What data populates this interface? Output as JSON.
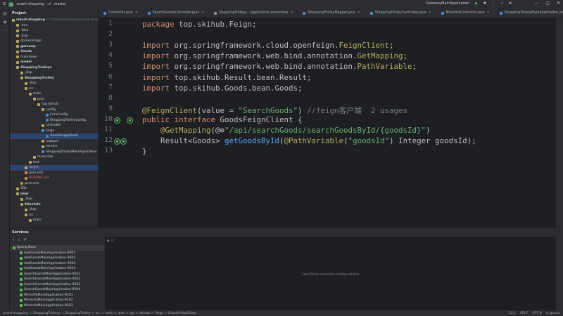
{
  "titlebar": {
    "project_badge": "SS",
    "project": "smart-shopping",
    "branch": "master",
    "run_config": "GatewayMainApplication"
  },
  "project_panel": {
    "title": "Project",
    "rows": [
      {
        "label": "smart-shopping",
        "hint": "C:\\Code\\JavaProject\\smart-shopping",
        "indent": 0,
        "bold": true
      },
      {
        "label": ".mrs",
        "indent": 1
      },
      {
        "label": ".idea",
        "indent": 1
      },
      {
        "label": ".jhsp",
        "indent": 1
      },
      {
        "label": "dockerimage",
        "indent": 1
      },
      {
        "label": "gateway",
        "indent": 1,
        "bold": true
      },
      {
        "label": "Goods",
        "indent": 1,
        "bold": true
      },
      {
        "label": "markdown",
        "indent": 1
      },
      {
        "label": "model",
        "indent": 1,
        "bold": true
      },
      {
        "label": "ShoppingTrolleys",
        "indent": 1,
        "bold": true
      },
      {
        "label": ".jhsp",
        "indent": 2
      },
      {
        "label": "ShoppingTrolley",
        "indent": 2,
        "bold": true
      },
      {
        "label": ".jhsp",
        "indent": 3
      },
      {
        "label": "src",
        "indent": 3
      },
      {
        "label": "main",
        "indent": 4
      },
      {
        "label": "java",
        "indent": 5
      },
      {
        "label": "top.skihub",
        "indent": 6
      },
      {
        "label": "config",
        "indent": 7
      },
      {
        "label": "CorsConfig",
        "indent": 8
      },
      {
        "label": "ShoppingTrolleyConfig",
        "indent": 8
      },
      {
        "label": "controller",
        "indent": 7
      },
      {
        "label": "Feign",
        "indent": 7
      },
      {
        "label": "GoodsFeignClient",
        "indent": 8,
        "selected": true
      },
      {
        "label": "mapper",
        "indent": 7
      },
      {
        "label": "service",
        "indent": 7
      },
      {
        "label": "ShoppingTrolleyMainApplication",
        "indent": 7
      },
      {
        "label": "resources",
        "indent": 5
      },
      {
        "label": "test",
        "indent": 4
      },
      {
        "label": "target",
        "indent": 3,
        "orange": true,
        "selected": true
      },
      {
        "label": "pom.xml",
        "indent": 3
      },
      {
        "label": "README.md",
        "indent": 3,
        "red": true
      },
      {
        "label": "pom.xml",
        "indent": 2
      },
      {
        "label": "SQL",
        "indent": 1
      },
      {
        "label": "User",
        "indent": 1,
        "bold": true
      },
      {
        "label": ".jhsp",
        "indent": 2
      },
      {
        "label": "MineInfo",
        "indent": 2,
        "bold": true
      },
      {
        "label": ".jhsp",
        "indent": 3
      },
      {
        "label": "src",
        "indent": 3
      },
      {
        "label": "main",
        "indent": 4
      }
    ]
  },
  "tabs": [
    {
      "label": "Controller.java"
    },
    {
      "label": "SearchGoodsController.java"
    },
    {
      "label": "ShoppingTrolley\\...\\application.properties"
    },
    {
      "label": "ShoppingTrolleyMapper.java"
    },
    {
      "label": "ShoppingTrolleyController.java"
    },
    {
      "label": "MineInfoController.java"
    },
    {
      "label": "ShoppingTrolleyMainApplication.java"
    },
    {
      "label": "GoodsFeignClient.java",
      "active": true
    }
  ],
  "editor": {
    "line_numbers": [
      "1",
      "2",
      "3",
      "4",
      "5",
      "6",
      "7",
      "8",
      "9",
      "10",
      "11",
      "12",
      "13"
    ],
    "lines": [
      [
        {
          "t": "package ",
          "c": "kw"
        },
        {
          "t": "top.skihub.Feign;"
        }
      ],
      [],
      [
        {
          "t": "import ",
          "c": "kw"
        },
        {
          "t": "org.springframework.cloud.openfeign."
        },
        {
          "t": "FeignClient",
          "c": "ann"
        },
        {
          "t": ";"
        }
      ],
      [
        {
          "t": "import ",
          "c": "kw"
        },
        {
          "t": "org.springframework.web.bind.annotation."
        },
        {
          "t": "GetMapping",
          "c": "ann"
        },
        {
          "t": ";"
        }
      ],
      [
        {
          "t": "import ",
          "c": "kw"
        },
        {
          "t": "org.springframework.web.bind.annotation."
        },
        {
          "t": "PathVariable",
          "c": "ann"
        },
        {
          "t": ";"
        }
      ],
      [
        {
          "t": "import ",
          "c": "kw"
        },
        {
          "t": "top.skihub.Result.bean.Result;"
        }
      ],
      [
        {
          "t": "import ",
          "c": "kw"
        },
        {
          "t": "top.skihub.Goods.bean.Goods;"
        }
      ],
      [],
      [
        {
          "t": "@FeignClient",
          "c": "ann"
        },
        {
          "t": "(value = "
        },
        {
          "t": "\"SearchGoods\"",
          "c": "str"
        },
        {
          "t": ") "
        },
        {
          "t": "//feign客户端",
          "c": "cm"
        },
        {
          "t": "  2 usages",
          "c": "cm"
        }
      ],
      [
        {
          "t": "public interface ",
          "c": "kw"
        },
        {
          "t": "GoodsFeignClient {"
        }
      ],
      [
        {
          "t": "    "
        },
        {
          "t": "@GetMapping",
          "c": "ann"
        },
        {
          "t": "(@⊕"
        },
        {
          "t": "\"/api/searchGoods/searchGoodsById/{goodsId}\"",
          "c": "str"
        },
        {
          "t": ")"
        }
      ],
      [
        {
          "t": "    Result<Goods> "
        },
        {
          "t": "getGoodsById",
          "c": "fn"
        },
        {
          "t": "("
        },
        {
          "t": "@PathVariable",
          "c": "ann"
        },
        {
          "t": "("
        },
        {
          "t": "\"goodsId\"",
          "c": "str"
        },
        {
          "t": ") Integer goodsId);"
        }
      ],
      [
        {
          "t": "}"
        }
      ]
    ]
  },
  "services": {
    "title": "Services",
    "hint": "Start/Stop selected configurations",
    "rows": [
      {
        "label": "Spring Boot",
        "group": true
      },
      {
        "label": "AddGoodsMainApplication-9001"
      },
      {
        "label": "AddGoodsMainApplication-9002"
      },
      {
        "label": "AddGoodsMainApplication-9004"
      },
      {
        "label": "AddGoodsMainApplication-9003"
      },
      {
        "label": "SearchGoodsMainApplication-9201"
      },
      {
        "label": "SearchGoodsMainApplication-9202"
      },
      {
        "label": "SearchGoodsMainApplication-9203"
      },
      {
        "label": "SearchGoodsMainApplication-9204"
      },
      {
        "label": "MineInfoMainApplication-9101"
      },
      {
        "label": "MineInfoMainApplication-9102"
      },
      {
        "label": "MineInfoMainApplication-9103"
      }
    ]
  },
  "statusbar": {
    "breadcrumb": "smart-shopping > ShoppingTrolleys > ShoppingTrolley > src > main > java > top > skihub > Feign > GoodsFeignClient",
    "position": "13:2",
    "line_sep": "CRLF",
    "encoding": "UTF-8",
    "indent": "4 spaces"
  }
}
